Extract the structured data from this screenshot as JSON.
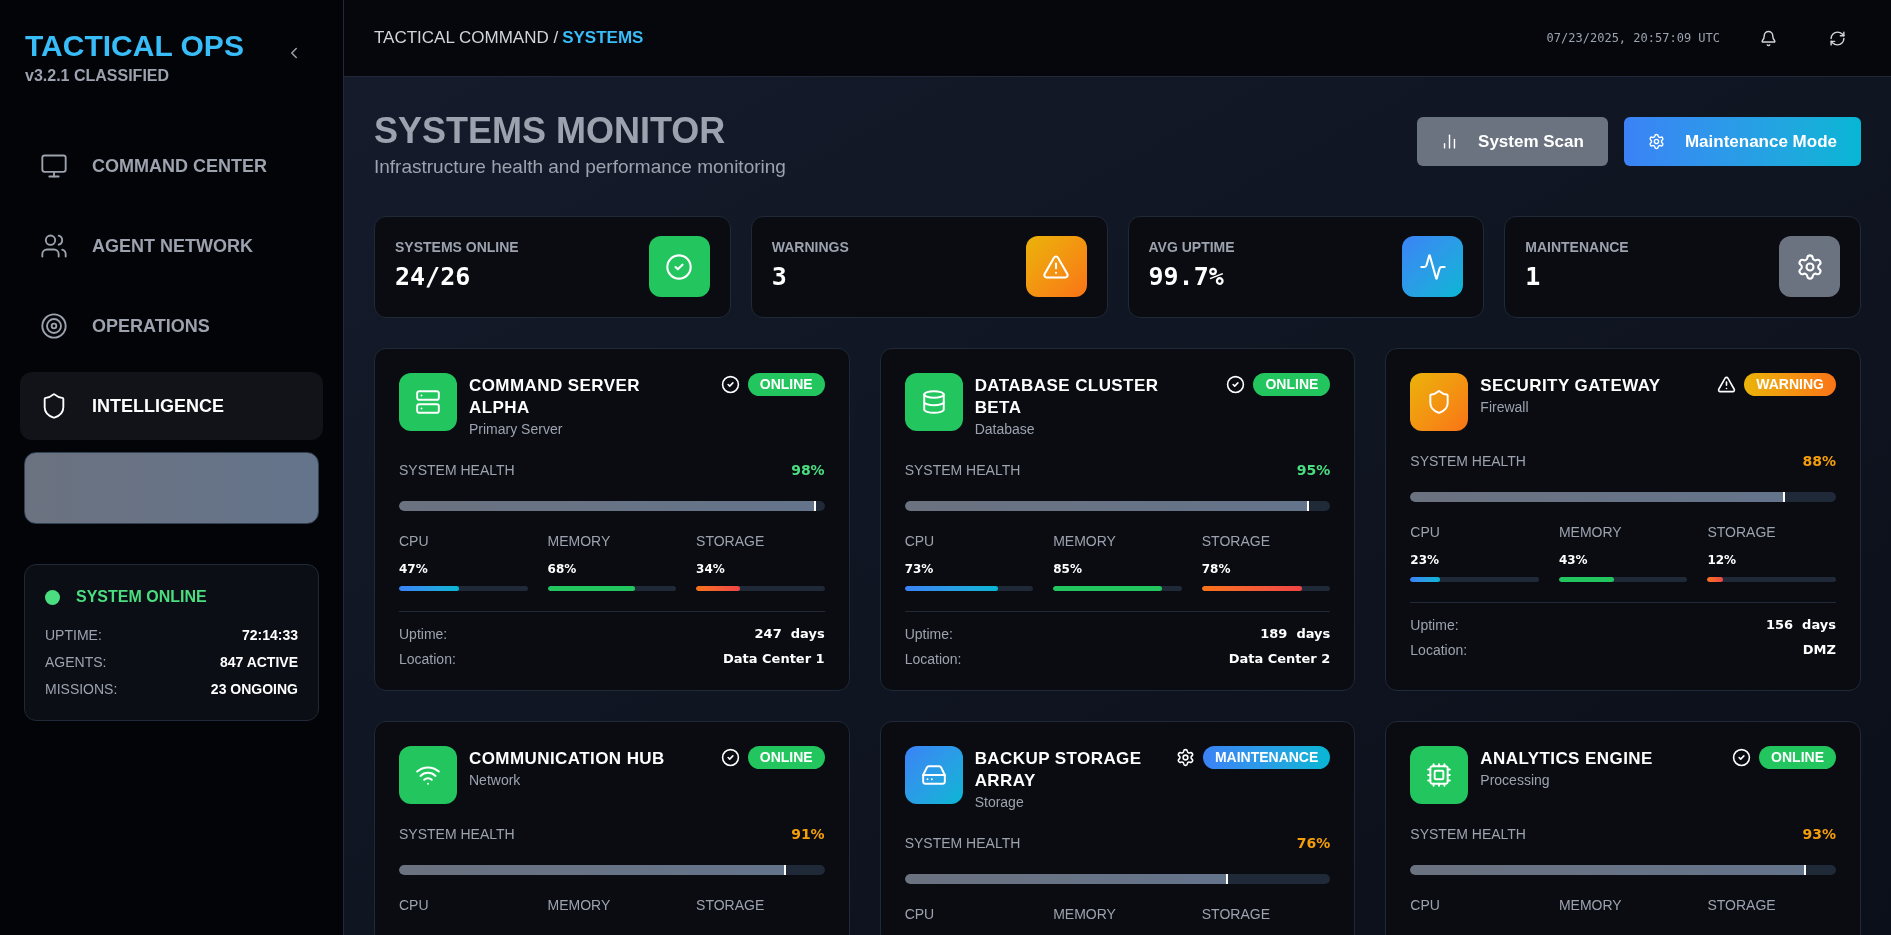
{
  "sidebar": {
    "title": "TACTICAL OPS",
    "subtitle": "v3.2.1 CLASSIFIED",
    "items": [
      {
        "label": "COMMAND CENTER",
        "selected": false
      },
      {
        "label": "AGENT NETWORK",
        "selected": false
      },
      {
        "label": "OPERATIONS",
        "selected": false
      },
      {
        "label": "INTELLIGENCE",
        "selected": true
      }
    ],
    "status": {
      "label": "SYSTEM ONLINE",
      "color": "#4ade80",
      "rows": [
        {
          "label": "UPTIME:",
          "value": "72:14:33"
        },
        {
          "label": "AGENTS:",
          "value": "847 ACTIVE"
        },
        {
          "label": "MISSIONS:",
          "value": "23 ONGOING"
        }
      ]
    }
  },
  "header": {
    "breadcrumb": "TACTICAL COMMAND /",
    "current": "SYSTEMS",
    "timestamp": "07/23/2025, 20:57:09 UTC"
  },
  "page": {
    "title": "SYSTEMS MONITOR",
    "subtitle": "Infrastructure health and performance monitoring",
    "buttons": [
      {
        "label": "System Scan",
        "kind": "secondary"
      },
      {
        "label": "Maintenance Mode",
        "kind": "primary"
      }
    ]
  },
  "stats": [
    {
      "label": "SYSTEMS ONLINE",
      "value": "24/26",
      "kind": "online"
    },
    {
      "label": "WARNINGS",
      "value": "3",
      "kind": "warning"
    },
    {
      "label": "AVG UPTIME",
      "value": "99.7%",
      "kind": "uptime"
    },
    {
      "label": "MAINTENANCE",
      "value": "1",
      "kind": "maintenance"
    }
  ],
  "systems": [
    {
      "name": "COMMAND SERVER ALPHA",
      "type": "Primary Server",
      "kind": "online",
      "status_label": "ONLINE",
      "health_label": "SYSTEM HEALTH",
      "health": {
        "value": "98%",
        "color": "#4ade80"
      },
      "level": 0.98,
      "metrics": [
        {
          "label": "CPU",
          "value": "47%",
          "level": 0.47
        },
        {
          "label": "MEMORY",
          "value": "68%",
          "level": 0.68
        },
        {
          "label": "STORAGE",
          "value": "34%",
          "level": 0.34
        }
      ],
      "details": [
        {
          "label": "Uptime:",
          "value": "247  days"
        },
        {
          "label": "Location:",
          "value": "Data Center 1"
        }
      ]
    },
    {
      "name": "DATABASE CLUSTER BETA",
      "type": "Database",
      "kind": "online",
      "status_label": "ONLINE",
      "health_label": "SYSTEM HEALTH",
      "health": {
        "value": "95%",
        "color": "#4ade80"
      },
      "level": 0.95,
      "metrics": [
        {
          "label": "CPU",
          "value": "73%",
          "level": 0.73
        },
        {
          "label": "MEMORY",
          "value": "85%",
          "level": 0.85
        },
        {
          "label": "STORAGE",
          "value": "78%",
          "level": 0.78
        }
      ],
      "details": [
        {
          "label": "Uptime:",
          "value": "189  days"
        },
        {
          "label": "Location:",
          "value": "Data Center 2"
        }
      ]
    },
    {
      "name": "SECURITY GATEWAY",
      "type": "Firewall",
      "kind": "warning",
      "status_label": "WARNING",
      "health_label": "SYSTEM HEALTH",
      "health": {
        "value": "88%",
        "color": "#f59e0b"
      },
      "level": 0.88,
      "metrics": [
        {
          "label": "CPU",
          "value": "23%",
          "level": 0.23
        },
        {
          "label": "MEMORY",
          "value": "43%",
          "level": 0.43
        },
        {
          "label": "STORAGE",
          "value": "12%",
          "level": 0.12
        }
      ],
      "details": [
        {
          "label": "Uptime:",
          "value": "156  days"
        },
        {
          "label": "Location:",
          "value": "DMZ"
        }
      ]
    },
    {
      "name": "COMMUNICATION HUB",
      "type": "Network",
      "kind": "online",
      "status_label": "ONLINE",
      "health_label": "SYSTEM HEALTH",
      "health": {
        "value": "91%",
        "color": "#f59e0b"
      },
      "level": 0.91,
      "metrics": [
        {
          "label": "CPU"
        },
        {
          "label": "MEMORY"
        },
        {
          "label": "STORAGE"
        }
      ]
    },
    {
      "name": "BACKUP STORAGE ARRAY",
      "type": "Storage",
      "kind": "maintenance",
      "status_label": "MAINTENANCE",
      "health_label": "SYSTEM HEALTH",
      "health": {
        "value": "76%",
        "color": "#f59e0b"
      },
      "level": 0.76,
      "metrics": [
        {
          "label": "CPU"
        },
        {
          "label": "MEMORY"
        },
        {
          "label": "STORAGE"
        }
      ]
    },
    {
      "name": "ANALYTICS ENGINE",
      "type": "Processing",
      "kind": "online",
      "status_label": "ONLINE",
      "health_label": "SYSTEM HEALTH",
      "health": {
        "value": "93%",
        "color": "#f59e0b"
      },
      "level": 0.93,
      "metrics": [
        {
          "label": "CPU"
        },
        {
          "label": "MEMORY"
        },
        {
          "label": "STORAGE"
        }
      ]
    }
  ]
}
